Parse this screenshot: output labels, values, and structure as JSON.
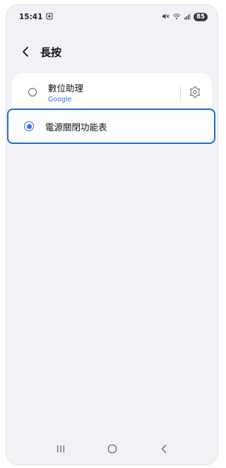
{
  "status_bar": {
    "time": "15:41",
    "battery": "85",
    "cam_icon": "screenshot-icon",
    "mute_icon": "mute-icon",
    "wifi_icon": "wifi-icon",
    "signal_icon": "signal-icon"
  },
  "header": {
    "title": "長按",
    "back_icon": "chevron-left-icon"
  },
  "options": [
    {
      "label": "數位助理",
      "sublabel": "Google",
      "selected": false
    },
    {
      "label": "電源關閉功能表",
      "selected": true
    }
  ],
  "colors": {
    "accent": "#3b6ee6",
    "highlight_border": "#1f6fc4",
    "background": "#f4f1f6",
    "card": "#ffffff"
  },
  "nav_bar": {
    "recents_icon": "recents-icon",
    "home_icon": "home-icon",
    "back_icon": "back-icon"
  }
}
